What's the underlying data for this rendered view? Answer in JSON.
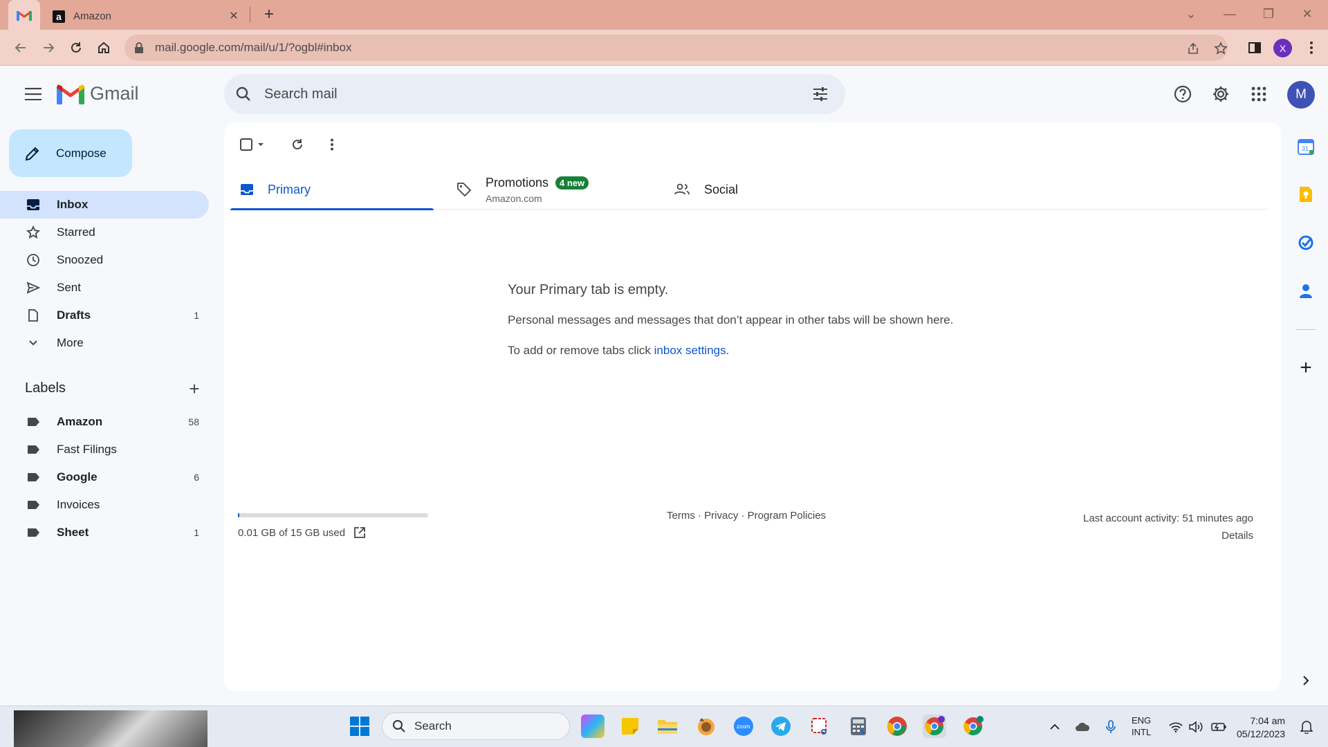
{
  "browser": {
    "tab_title": "Amazon",
    "url": "mail.google.com/mail/u/1/?ogbl#inbox",
    "profile_initial": "X"
  },
  "header": {
    "app_name": "Gmail",
    "search_placeholder": "Search mail",
    "account_initial": "M"
  },
  "compose_label": "Compose",
  "nav": {
    "items": [
      {
        "label": "Inbox",
        "count": "",
        "icon": "inbox-icon",
        "bold": true,
        "active": true
      },
      {
        "label": "Starred",
        "count": "",
        "icon": "star-icon"
      },
      {
        "label": "Snoozed",
        "count": "",
        "icon": "clock-icon"
      },
      {
        "label": "Sent",
        "count": "",
        "icon": "send-icon"
      },
      {
        "label": "Drafts",
        "count": "1",
        "icon": "draft-icon",
        "bold": true
      },
      {
        "label": "More",
        "count": "",
        "icon": "chevron-down-icon"
      }
    ]
  },
  "labels": {
    "title": "Labels",
    "items": [
      {
        "label": "Amazon",
        "count": "58",
        "bold": true
      },
      {
        "label": "Fast Filings",
        "count": ""
      },
      {
        "label": "Google",
        "count": "6",
        "bold": true
      },
      {
        "label": "Invoices",
        "count": ""
      },
      {
        "label": "Sheet",
        "count": "1",
        "bold": true
      }
    ]
  },
  "tabs": {
    "primary": "Primary",
    "promotions": "Promotions",
    "promotions_badge": "4 new",
    "promotions_sub": "Amazon.com",
    "social": "Social"
  },
  "empty": {
    "title": "Your Primary tab is empty.",
    "line1": "Personal messages and messages that don’t appear in other tabs will be shown here.",
    "line2_prefix": "To add or remove tabs click ",
    "line2_link": "inbox settings",
    "line2_suffix": "."
  },
  "footer": {
    "storage": "0.01 GB of 15 GB used",
    "storage_fraction": 0.0007,
    "links": "Terms · Privacy · Program Policies",
    "activity": "Last account activity: 51 minutes ago",
    "details": "Details"
  },
  "taskbar": {
    "search": "Search",
    "lang_line1": "ENG",
    "lang_line2": "INTL",
    "time": "7:04 am",
    "date": "05/12/2023"
  },
  "colors": {
    "accent": "#0b57d0",
    "compose_bg": "#c2e7ff",
    "active_nav": "#d3e3fd",
    "badge": "#188038"
  }
}
